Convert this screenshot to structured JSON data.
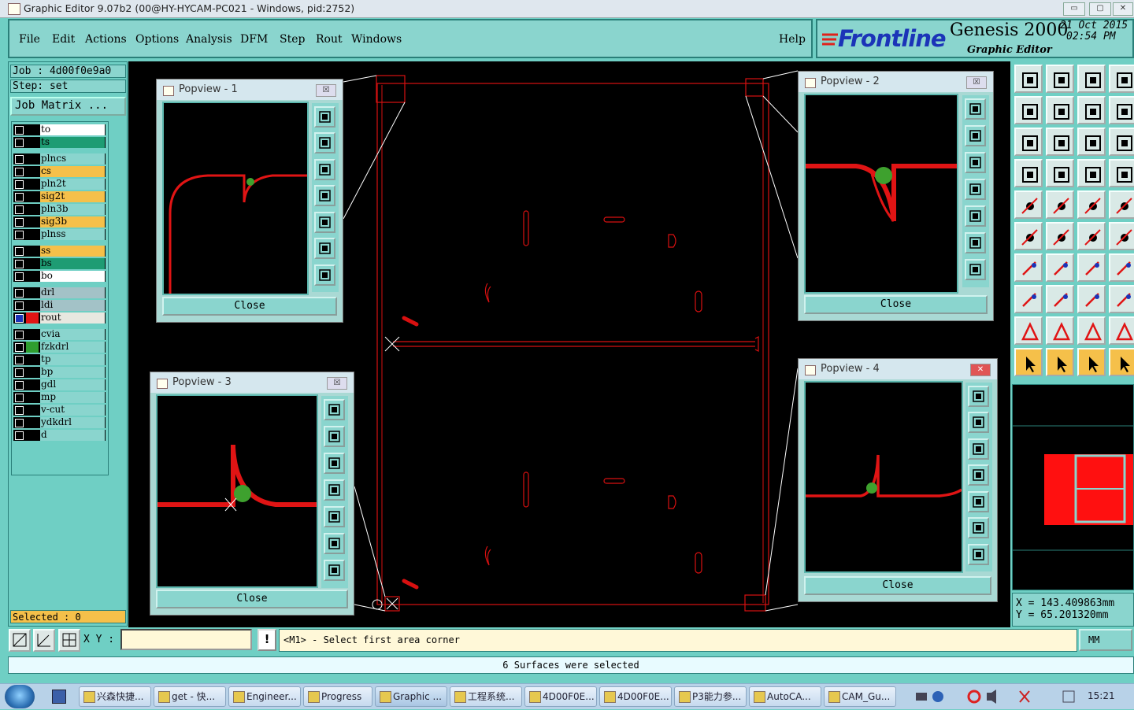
{
  "window": {
    "title": "Graphic Editor 9.07b2 (00@HY-HYCAM-PC021 - Windows, pid:2752)",
    "btn_min": "▭",
    "btn_max": "▢",
    "btn_close": "✕"
  },
  "menu": {
    "items": [
      "File",
      "Edit",
      "Actions",
      "Options",
      "Analysis",
      "DFM",
      "Step",
      "Rout",
      "Windows"
    ],
    "help": "Help"
  },
  "brand": {
    "logo": "Frontline",
    "product": "Genesis 2000",
    "subtitle": "Graphic Editor",
    "date": "21 Oct 2015",
    "time": "02:54 PM",
    "colors": {
      "logo_blue": "#1b34b8",
      "logo_red": "#e0221b"
    }
  },
  "job": {
    "job_label": "Job : 4d00f0e9a0",
    "step_label": "Step: set",
    "matrix_button": "Job Matrix ..."
  },
  "layers": [
    {
      "name": "to",
      "color": "#ffffff",
      "group": 1
    },
    {
      "name": "ts",
      "color": "#1e9c73",
      "group": 1
    },
    {
      "name": "plncs",
      "color": "#8ad5ce",
      "group": 2
    },
    {
      "name": "cs",
      "color": "#f5c04a",
      "group": 2
    },
    {
      "name": "pln2t",
      "color": "#8ad5ce",
      "group": 2
    },
    {
      "name": "sig2t",
      "color": "#f5c04a",
      "group": 2
    },
    {
      "name": "pln3b",
      "color": "#8ad5ce",
      "group": 2
    },
    {
      "name": "sig3b",
      "color": "#f5c04a",
      "group": 2
    },
    {
      "name": "plnss",
      "color": "#8ad5ce",
      "group": 2
    },
    {
      "name": "ss",
      "color": "#f5c04a",
      "group": 3
    },
    {
      "name": "bs",
      "color": "#1e9c73",
      "group": 3
    },
    {
      "name": "bo",
      "color": "#ffffff",
      "group": 3
    },
    {
      "name": "drl",
      "color": "#a3c2c7",
      "group": 4
    },
    {
      "name": "ldi",
      "color": "#a3c2c7",
      "group": 4
    },
    {
      "name": "rout",
      "color": "#e8e8e0",
      "group": 4,
      "active": true
    },
    {
      "name": "cvia",
      "color": "#8ad5ce",
      "group": 5
    },
    {
      "name": "fzkdrl",
      "color": "#8ad5ce",
      "group": 5,
      "swatch": "#2f9e2f"
    },
    {
      "name": "tp",
      "color": "#8ad5ce",
      "group": 5
    },
    {
      "name": "bp",
      "color": "#8ad5ce",
      "group": 5
    },
    {
      "name": "gdl",
      "color": "#8ad5ce",
      "group": 5
    },
    {
      "name": "mp",
      "color": "#8ad5ce",
      "group": 5
    },
    {
      "name": "v-cut",
      "color": "#8ad5ce",
      "group": 5
    },
    {
      "name": "ydkdrl",
      "color": "#8ad5ce",
      "group": 5
    },
    {
      "name": "d",
      "color": "#8ad5ce",
      "group": 5
    }
  ],
  "selected_label": "Selected : 0",
  "popviews": [
    {
      "title": "Popview - 1",
      "close": "Close",
      "x_glyph": "☒"
    },
    {
      "title": "Popview - 2",
      "close": "Close",
      "x_glyph": "☒"
    },
    {
      "title": "Popview - 3",
      "close": "Close",
      "x_glyph": "☒"
    },
    {
      "title": "Popview - 4",
      "close": "Close",
      "x_glyph": "✕"
    }
  ],
  "right_toolbar_icons": [
    "move-up-icon",
    "move-down-icon",
    "home-icon",
    "frame-icon",
    "move-left-icon",
    "move-right-icon",
    "mirror-icon",
    "snap-icon",
    "zoom-fit-icon",
    "zoom-center-icon",
    "ratio-icon",
    "help-icon",
    "measure-icon",
    "stamp-icon",
    "net-icon",
    "net2-icon",
    "pad-icon",
    "fill-icon",
    "ruler-icon",
    "circle-icon",
    "connect-icon",
    "cross-icon",
    "add-pad-icon",
    "add-dot-icon",
    "line-icon",
    "line2-icon",
    "arc-icon",
    "split-icon",
    "select-box-icon",
    "min-icon",
    "zoom-box-icon",
    "copy-icon",
    "tri-icon",
    "text-a-icon",
    "text-a2-icon",
    "text-a3-icon",
    "pointer-icon",
    "pointer2-icon",
    "pointer3-icon",
    "pointer4-icon"
  ],
  "coords": {
    "x": "X  =  143.409863mm",
    "y": "Y  =  65.201320mm"
  },
  "bottom": {
    "xy_label": "X Y :",
    "xy_value": "",
    "bang": "!",
    "prompt": "<M1> - Select first area corner",
    "units": "MM",
    "status": "6 Surfaces were selected"
  },
  "taskbar": {
    "tasks": [
      "兴森快捷...",
      "get - 快...",
      "Engineer...",
      "Progress",
      "Graphic ...",
      "工程系统...",
      "4D00F0E...",
      "4D00F0E...",
      "P3能力参...",
      "AutoCA...",
      "CAM_Gu..."
    ],
    "active_index": 4,
    "clock": "15:21"
  }
}
